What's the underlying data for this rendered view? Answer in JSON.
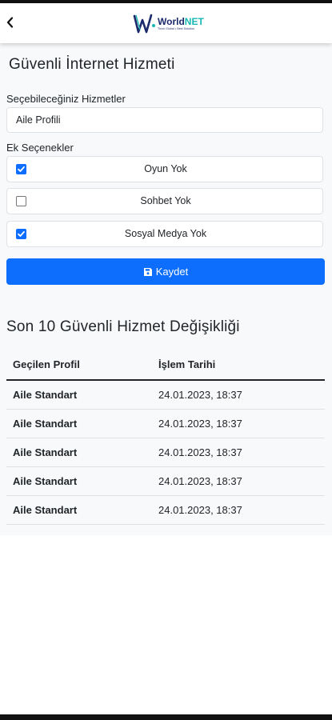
{
  "header": {
    "back_icon": "chevron-left-icon",
    "logo_word_1": "World",
    "logo_word_2": "NET",
    "logo_tagline": "Think Global • Best Solution"
  },
  "form": {
    "title": "Güvenli İnternet Hizmeti",
    "services_label": "Seçebileceğiniz Hizmetler",
    "selected_service": "Aile Profili",
    "extras_label": "Ek Seçenekler",
    "options": [
      {
        "label": "Oyun Yok",
        "checked": true
      },
      {
        "label": "Sohbet Yok",
        "checked": false
      },
      {
        "label": "Sosyal Medya Yok",
        "checked": true
      }
    ],
    "save_label": "Kaydet",
    "save_icon": "floppy-disk-icon"
  },
  "history": {
    "title": "Son 10 Güvenli Hizmet Değişikliği",
    "columns": [
      "Geçilen Profil",
      "İşlem Tarihi"
    ],
    "rows": [
      [
        "Aile Standart",
        "24.01.2023, 18:37"
      ],
      [
        "Aile Standart",
        "24.01.2023, 18:37"
      ],
      [
        "Aile Standart",
        "24.01.2023, 18:37"
      ],
      [
        "Aile Standart",
        "24.01.2023, 18:37"
      ],
      [
        "Aile Standart",
        "24.01.2023, 18:37"
      ]
    ]
  },
  "colors": {
    "primary": "#0d6efd",
    "page_bg": "#f8f9fa",
    "logo_navy": "#1a2a6c",
    "logo_teal": "#17b8b0"
  }
}
